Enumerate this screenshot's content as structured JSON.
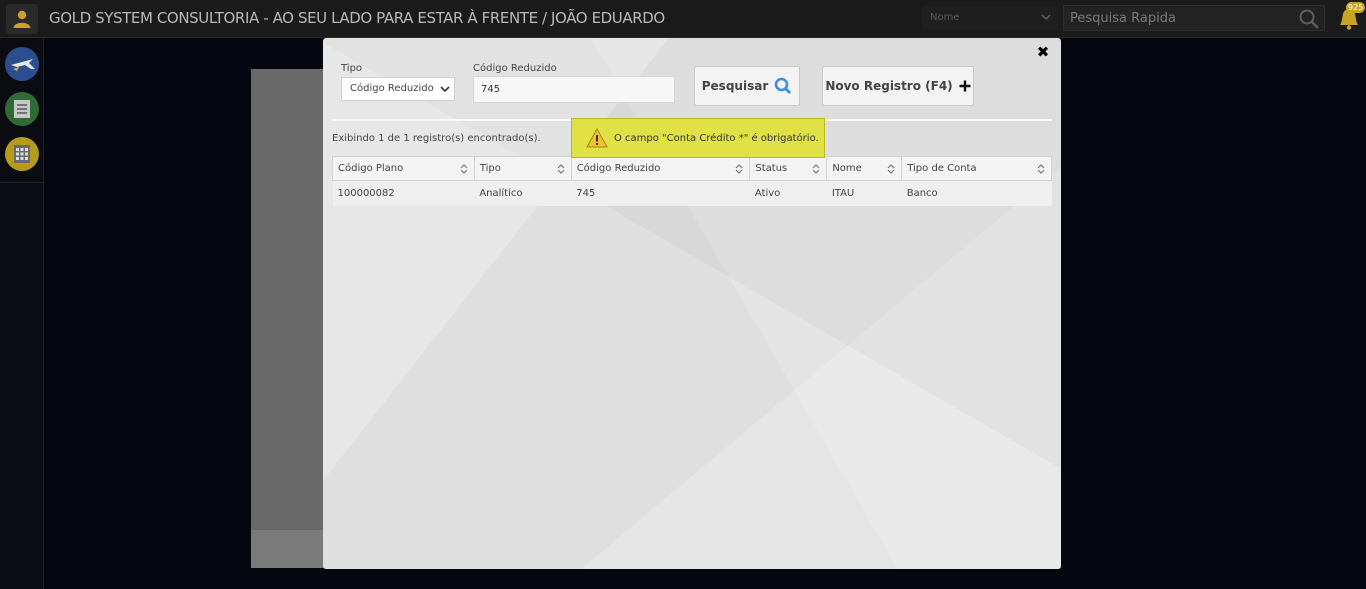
{
  "topbar": {
    "title": "GOLD SYSTEM CONSULTORIA - AO SEU LADO PARA ESTAR À FRENTE / JOÃO EDUARDO",
    "search_field_select": "Nome",
    "quick_search_placeholder": "Pesquisa Rapida",
    "notification_count": "925",
    "user_icon": "user-icon",
    "bell_icon": "bell-icon"
  },
  "sidebar": {
    "items": [
      {
        "icon": "plane-icon",
        "color": "#2b4f8e"
      },
      {
        "icon": "ledger-icon",
        "color": "#2f6b34"
      },
      {
        "icon": "calculator-icon",
        "color": "#b59a1c"
      }
    ]
  },
  "modal": {
    "tipo_label": "Tipo",
    "tipo_value": "Código Reduzido",
    "codigo_label": "Código Reduzido",
    "codigo_value": "745",
    "search_button": "Pesquisar",
    "new_button": "Novo Registro (F4)",
    "result_count": "Exibindo 1 de 1 registro(s) encontrado(s).",
    "alert_message": "O campo \"Conta Crédito *\" é obrigatório.",
    "table": {
      "columns": [
        "Código Plano",
        "Tipo",
        "Código Reduzido",
        "Status",
        "Nome",
        "Tipo de Conta"
      ],
      "rows": [
        [
          "100000082",
          "Analítico",
          "745",
          "Ativo",
          "ITAU",
          "Banco"
        ]
      ]
    },
    "close_symbol": "✖"
  },
  "colors": {
    "alert_bg": "#dfe144",
    "search_icon": "#3a8ee6"
  }
}
